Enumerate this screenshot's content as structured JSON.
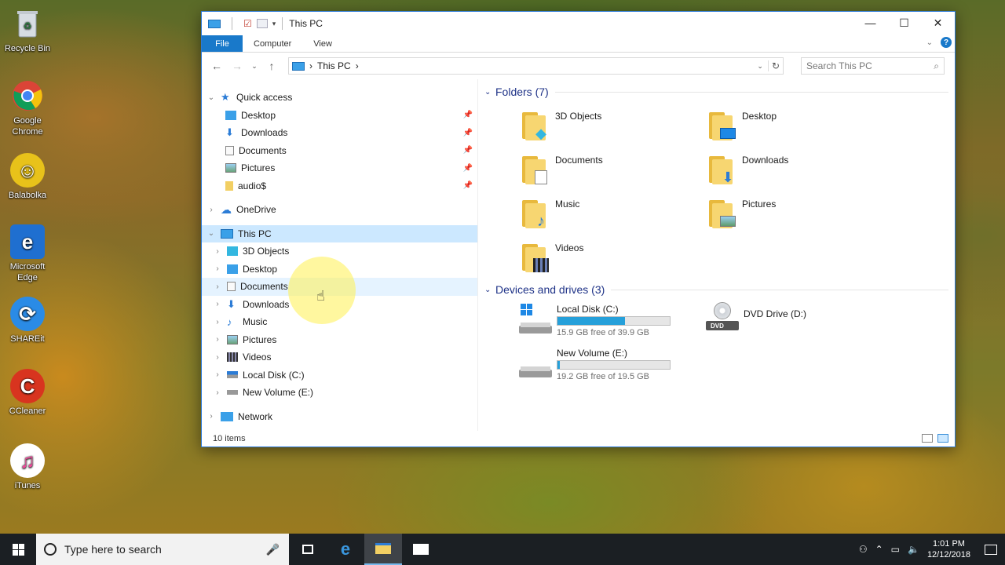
{
  "desktop": {
    "icons": [
      {
        "label": "Recycle Bin",
        "icon": "recycle-bin-icon",
        "color": "#9aa4ad"
      },
      {
        "label": "Google Chrome",
        "icon": "chrome-icon",
        "color": "#db4437"
      },
      {
        "label": "Balabolka",
        "icon": "balabolka-icon",
        "color": "#e8c21a"
      },
      {
        "label": "Microsoft Edge",
        "icon": "edge-icon",
        "color": "#1f6fd0"
      },
      {
        "label": "SHAREit",
        "icon": "shareit-icon",
        "color": "#2a8be6"
      },
      {
        "label": "CCleaner",
        "icon": "ccleaner-icon",
        "color": "#d8341f"
      },
      {
        "label": "iTunes",
        "icon": "itunes-icon",
        "color": "#ec4b9a"
      }
    ]
  },
  "window": {
    "title": "This PC",
    "tabs": {
      "file": "File",
      "computer": "Computer",
      "view": "View"
    },
    "address": {
      "location": "This PC",
      "sep": "›"
    },
    "search_placeholder": "Search This PC"
  },
  "nav": {
    "quick_access": "Quick access",
    "quick_items": [
      {
        "label": "Desktop",
        "icon": "desktop-icon"
      },
      {
        "label": "Downloads",
        "icon": "downloads-icon"
      },
      {
        "label": "Documents",
        "icon": "documents-icon"
      },
      {
        "label": "Pictures",
        "icon": "pictures-icon"
      },
      {
        "label": "audio$",
        "icon": "folder-icon"
      }
    ],
    "onedrive": "OneDrive",
    "this_pc": "This PC",
    "pc_items": [
      {
        "label": "3D Objects",
        "icon": "3d-objects-icon"
      },
      {
        "label": "Desktop",
        "icon": "desktop-icon"
      },
      {
        "label": "Documents",
        "icon": "documents-icon"
      },
      {
        "label": "Downloads",
        "icon": "downloads-icon"
      },
      {
        "label": "Music",
        "icon": "music-icon"
      },
      {
        "label": "Pictures",
        "icon": "pictures-icon"
      },
      {
        "label": "Videos",
        "icon": "videos-icon"
      },
      {
        "label": "Local Disk (C:)",
        "icon": "local-disk-icon"
      },
      {
        "label": "New Volume (E:)",
        "icon": "drive-icon"
      }
    ],
    "network": "Network"
  },
  "content": {
    "folders_header": "Folders (7)",
    "folders": [
      {
        "label": "3D Objects",
        "icon": "3d-objects-icon"
      },
      {
        "label": "Desktop",
        "icon": "desktop-icon"
      },
      {
        "label": "Documents",
        "icon": "documents-icon"
      },
      {
        "label": "Downloads",
        "icon": "downloads-icon"
      },
      {
        "label": "Music",
        "icon": "music-icon"
      },
      {
        "label": "Pictures",
        "icon": "pictures-icon"
      },
      {
        "label": "Videos",
        "icon": "videos-icon"
      }
    ],
    "devices_header": "Devices and drives (3)",
    "drives": [
      {
        "label": "Local Disk (C:)",
        "free": "15.9 GB free of 39.9 GB",
        "used_fraction": 0.6
      },
      {
        "label": "DVD Drive (D:)",
        "free": "",
        "used_fraction": null
      },
      {
        "label": "New Volume (E:)",
        "free": "19.2 GB free of 19.5 GB",
        "used_fraction": 0.02
      }
    ]
  },
  "status": {
    "items": "10 items"
  },
  "taskbar": {
    "search_placeholder": "Type here to search",
    "time": "1:01 PM",
    "date": "12/12/2018"
  },
  "colors": {
    "accent": "#1979ca",
    "selection": "#cce8ff",
    "header": "#1e3287",
    "drive_fill": "#26a0da"
  }
}
